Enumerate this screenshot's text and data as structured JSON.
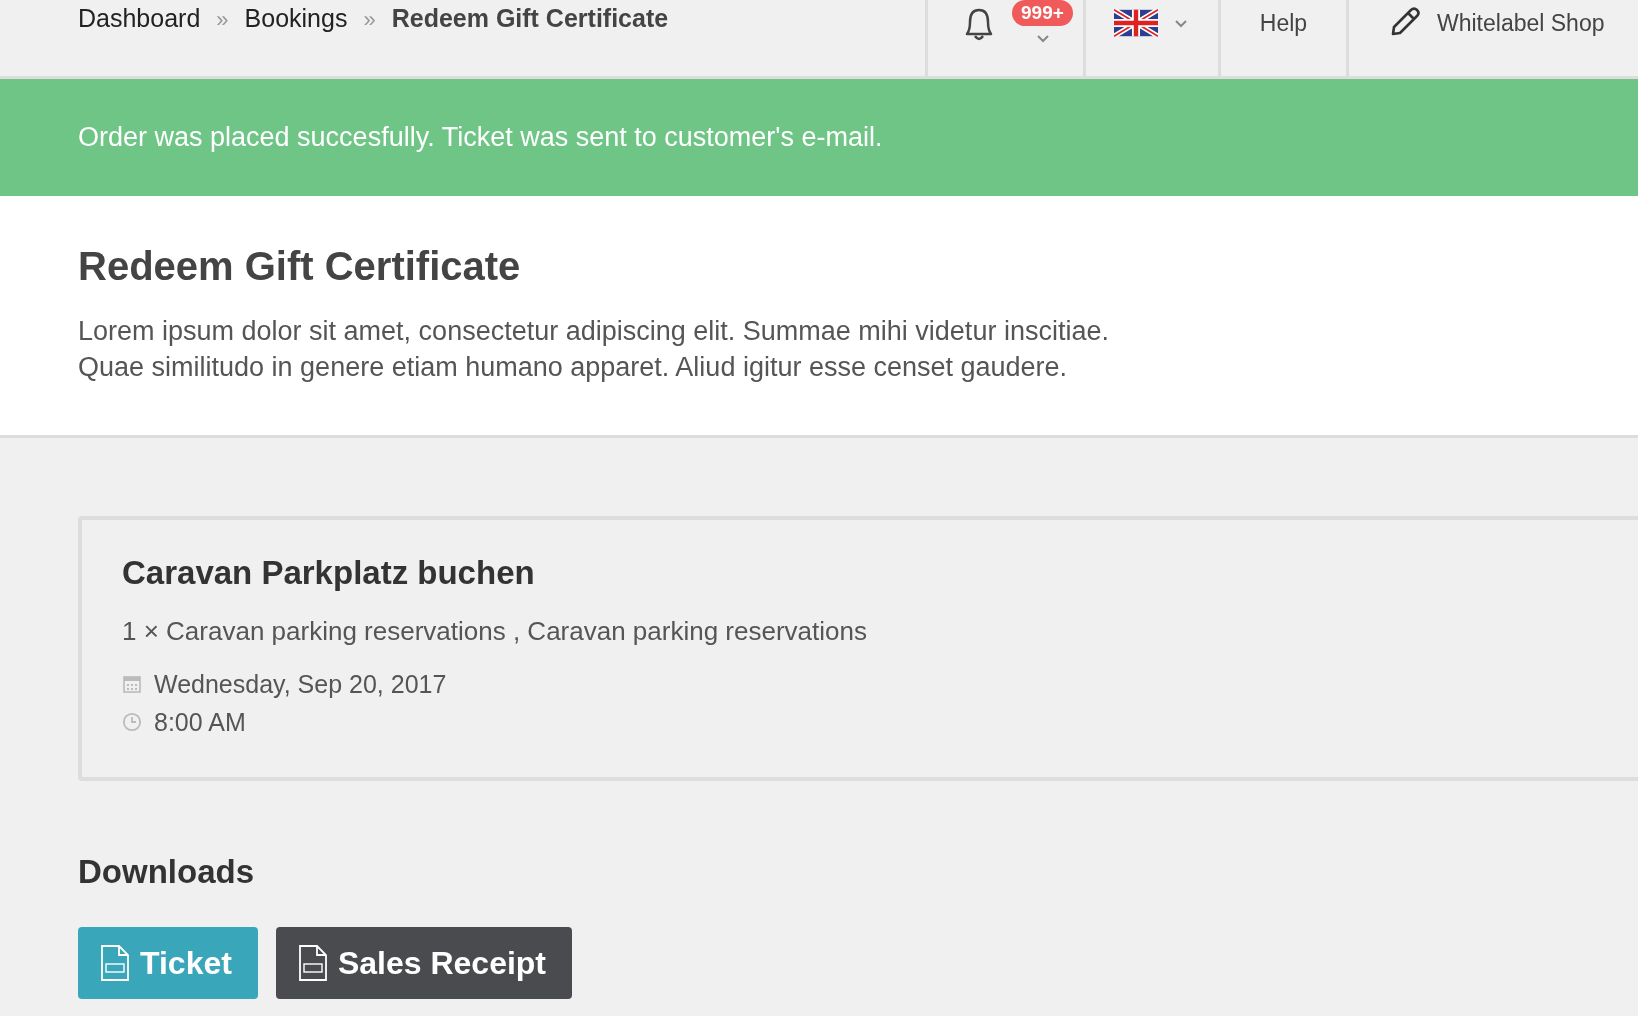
{
  "breadcrumb": [
    {
      "label": "Dashboard",
      "current": false
    },
    {
      "label": "Bookings",
      "current": false
    },
    {
      "label": "Redeem Gift Certificate",
      "current": true
    }
  ],
  "breadcrumb_separator": "»",
  "header": {
    "notification_badge": "999+",
    "help": "Help",
    "shop": "Whitelabel Shop"
  },
  "alert": {
    "message": "Order was placed succesfully. Ticket was sent to customer's e-mail."
  },
  "page": {
    "title": "Redeem Gift Certificate",
    "description": [
      "Lorem ipsum dolor sit amet, consectetur adipiscing elit. Summae mihi videtur inscitiae.",
      "Quae similitudo in genere etiam humano apparet. Aliud igitur esse censet gaudere."
    ]
  },
  "booking": {
    "title": "Caravan Parkplatz buchen",
    "items": "1 × Caravan parking reservations , Caravan parking reservations",
    "date": "Wednesday, Sep 20, 2017",
    "time": "8:00 AM"
  },
  "downloads": {
    "title": "Downloads",
    "buttons": [
      {
        "label": "Ticket",
        "kind": "primary"
      },
      {
        "label": "Sales Receipt",
        "kind": "dark"
      }
    ]
  }
}
